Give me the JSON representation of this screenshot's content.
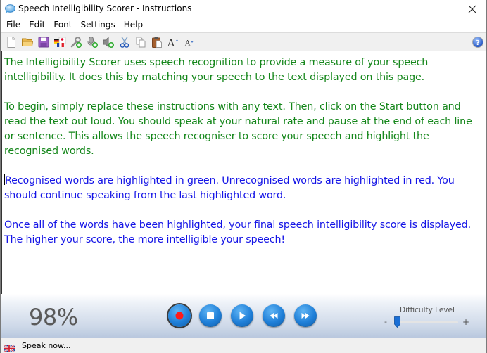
{
  "window": {
    "title": "Speech Intelligibility Scorer - Instructions",
    "app_icon": "speech-bubble-icon",
    "close_icon": "close-icon"
  },
  "menu": {
    "items": [
      {
        "label": "File"
      },
      {
        "label": "Edit"
      },
      {
        "label": "Font"
      },
      {
        "label": "Settings"
      },
      {
        "label": "Help"
      }
    ]
  },
  "toolbar": {
    "buttons": [
      {
        "icon": "new-document-icon",
        "tooltip": "New"
      },
      {
        "icon": "open-folder-icon",
        "tooltip": "Open"
      },
      {
        "icon": "save-icon",
        "tooltip": "Save"
      },
      {
        "icon": "language-flags-icon",
        "tooltip": "Language"
      },
      {
        "icon": "wrench-add-icon",
        "tooltip": "Settings"
      },
      {
        "icon": "microphone-add-icon",
        "tooltip": "Microphone"
      },
      {
        "icon": "speaker-add-icon",
        "tooltip": "Speaker"
      },
      {
        "icon": "cut-icon",
        "tooltip": "Cut"
      },
      {
        "icon": "copy-icon",
        "tooltip": "Copy"
      },
      {
        "icon": "paste-icon",
        "tooltip": "Paste"
      },
      {
        "icon": "font-increase-icon",
        "tooltip": "Increase font size"
      },
      {
        "icon": "font-decrease-icon",
        "tooltip": "Decrease font size"
      }
    ],
    "help_icon": "help-icon"
  },
  "editor": {
    "paragraphs": [
      {
        "color": "green",
        "text": "The Intelligibility Scorer uses speech recognition to provide a measure of your speech intelligibility. It does this by matching your speech to the text displayed on this page."
      },
      {
        "color": "green",
        "text": "To begin, simply replace these instructions with any text. Then, click on the Start button and read the text out loud. You should speak at your natural rate and pause at the end of each line or sentence. This allows the speech recogniser to score your speech and highlight the recognised words."
      },
      {
        "color": "blue",
        "text": "Recognised words are highlighted in green. Unrecognised words are highlighted in red. You should continue speaking from the last highlighted word."
      },
      {
        "color": "blue",
        "text": "Once all of the words have been highlighted, your final speech intelligibility score is displayed. The higher your score, the more intelligible your speech!"
      }
    ],
    "colors": {
      "green": "#14861a",
      "blue": "#1414e6"
    }
  },
  "controls": {
    "score": "98%",
    "buttons": [
      {
        "icon": "record-icon",
        "label": "Record"
      },
      {
        "icon": "stop-icon",
        "label": "Stop"
      },
      {
        "icon": "play-icon",
        "label": "Play"
      },
      {
        "icon": "rewind-icon",
        "label": "Rewind"
      },
      {
        "icon": "fast-forward-icon",
        "label": "Fast forward"
      }
    ],
    "difficulty": {
      "label": "Difficulty Level",
      "min_label": "-",
      "max_label": "+",
      "value_fraction": 0.03
    }
  },
  "statusbar": {
    "flag_icon": "uk-flag-icon",
    "text": "Speak now..."
  }
}
